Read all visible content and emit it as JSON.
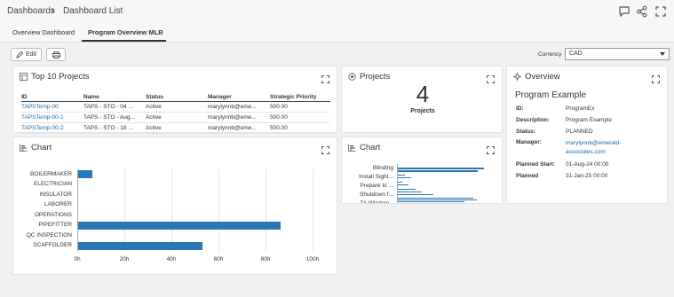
{
  "breadcrumb": {
    "root": "Dashboards",
    "sep": "›",
    "current": "Dashboard List"
  },
  "tabs": [
    {
      "label": "Overview Dashboard",
      "active": false
    },
    {
      "label": "Program Overview MLB",
      "active": true
    }
  ],
  "toolbar": {
    "edit_label": "Edit",
    "currency_label": "Currency",
    "currency_value": "CAD"
  },
  "top_projects": {
    "title": "Top 10 Projects",
    "columns": [
      "ID",
      "Name",
      "Status",
      "Manager",
      "Strategic Priority"
    ],
    "rows": [
      [
        "TAPSTemp-00",
        "TAPS - STO - 04 ...",
        "Active",
        "marylynnb@eme...",
        "500.00"
      ],
      [
        "TAPSTemp-00-1",
        "TAPS - STO - Aug...",
        "Active",
        "marylynnb@eme...",
        "500.00"
      ],
      [
        "TAPSTemp-00-2",
        "TAPS - STO - 18 ...",
        "Active",
        "marylynnb@eme...",
        "500.00"
      ]
    ]
  },
  "projects_card": {
    "title": "Projects",
    "count": "4",
    "label": "Projects"
  },
  "overview": {
    "title": "Overview",
    "program_name": "Program Example",
    "fields": [
      {
        "key": "ID:",
        "value": "ProgramEx",
        "link": false
      },
      {
        "key": "Description:",
        "value": "Program Example",
        "link": false
      },
      {
        "key": "Status:",
        "value": "PLANNED",
        "link": false
      },
      {
        "key": "Manager:",
        "value": "marylynnb@emerald-associates.com",
        "link": true
      },
      {
        "key": "Planned Start:",
        "value": "01-Aug-24 00:00",
        "link": false
      },
      {
        "key": "Planned",
        "value": "31-Jan-25 00:00",
        "link": false
      }
    ]
  },
  "chart_main": {
    "title": "Chart"
  },
  "chart_small": {
    "title": "Chart",
    "labels": [
      "Blinding",
      "Install Sight...",
      "Prepare to ...",
      "Shutdown f...",
      "TA Window..."
    ]
  },
  "colors": {
    "bar": "#2b77b5",
    "link": "#1a6aa8",
    "tab_active_underline": "#333333"
  },
  "chart_data": {
    "type": "bar",
    "orientation": "horizontal",
    "categories": [
      "BOILERMAKER",
      "ELECTRICIAN",
      "INSULATOR",
      "LABORER",
      "OPERATIONS",
      "PIPEFITTER",
      "QC INSPECTION",
      "SCAFFOLDER"
    ],
    "values": [
      6,
      0,
      0,
      0,
      0,
      86,
      0,
      53
    ],
    "x_ticks": [
      "0h",
      "20h",
      "40h",
      "60h",
      "80h",
      "100h"
    ],
    "xlim": [
      0,
      100
    ],
    "grid": true
  }
}
